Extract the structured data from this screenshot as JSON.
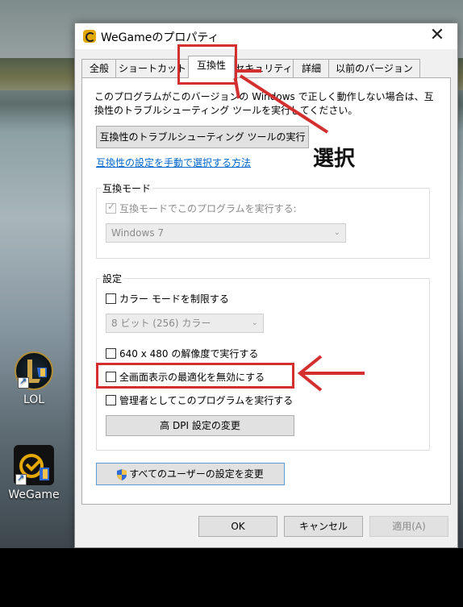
{
  "desktop": {
    "icons": [
      {
        "label": "LOL"
      },
      {
        "label": "WeGame"
      }
    ]
  },
  "dialog": {
    "title": "WeGameのプロパティ",
    "close_glyph": "✕",
    "tabs": [
      {
        "label": "全般"
      },
      {
        "label": "ショートカット"
      },
      {
        "label": "互換性"
      },
      {
        "label": "セキュリティ"
      },
      {
        "label": "詳細"
      },
      {
        "label": "以前のバージョン"
      }
    ],
    "active_tab": "互換性",
    "description": "このプログラムがこのバージョンの Windows で正しく動作しない場合は、互換性のトラブルシューティング ツールを実行してください。",
    "troubleshoot_button": "互換性のトラブルシューティング ツールの実行",
    "manual_link": "互換性の設定を手動で選択する方法",
    "compat_mode": {
      "group_label": "互換モード",
      "checkbox_label": "互換モードでこのプログラムを実行する:",
      "checked": true,
      "select_value": "Windows 7"
    },
    "settings": {
      "group_label": "設定",
      "color_mode_label": "カラー モードを制限する",
      "color_select_value": "8 ビット (256) カラー",
      "res_label": "640 x 480 の解像度で実行する",
      "fullscreen_label": "全画面表示の最適化を無効にする",
      "admin_label": "管理者としてこのプログラムを実行する",
      "dpi_button": "高 DPI 設定の変更"
    },
    "all_users_button": "すべてのユーザーの設定を変更",
    "buttons": {
      "ok": "OK",
      "cancel": "キャンセル",
      "apply": "適用(A)"
    }
  },
  "annotation": {
    "callout": "選択",
    "color": "#d32f2f"
  }
}
